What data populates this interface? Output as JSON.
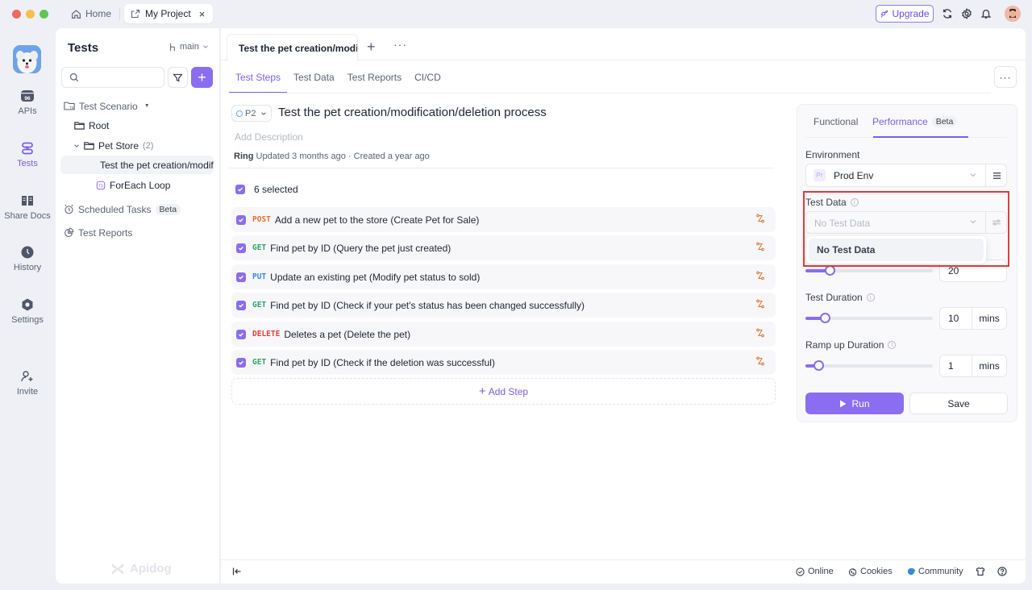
{
  "window": {
    "tabs": [
      {
        "label": "Home",
        "icon": "home-icon"
      },
      {
        "label": "My Project",
        "icon": "external-link-icon",
        "active": true
      }
    ],
    "upgrade_label": "Upgrade",
    "toolbar_icons": [
      "refresh-icon",
      "gear-icon",
      "bell-icon",
      "avatar"
    ]
  },
  "rail": {
    "items": [
      {
        "label": "APIs",
        "icon": "api-icon"
      },
      {
        "label": "Tests",
        "icon": "tests-icon",
        "active": true
      },
      {
        "label": "Share Docs",
        "icon": "book-icon"
      },
      {
        "label": "History",
        "icon": "clock-icon"
      },
      {
        "label": "Settings",
        "icon": "settings-icon"
      },
      {
        "label": "Invite",
        "icon": "user-plus-icon"
      }
    ]
  },
  "sidebar": {
    "title": "Tests",
    "branch": "main",
    "search": {
      "value": "",
      "placeholder": ""
    },
    "tree": {
      "scenario_label": "Test Scenario",
      "root_label": "Root",
      "folder_label": "Pet Store",
      "folder_count": "(2)",
      "cases": [
        "Test the pet creation/modification/deletion process",
        "ForEach Loop"
      ]
    },
    "scheduled_label": "Scheduled Tasks",
    "scheduled_badge": "Beta",
    "reports_label": "Test Reports",
    "brand": "Apidog"
  },
  "main": {
    "doc_tab_label": "Test the pet creation/modification/deletion process",
    "sub_tabs": [
      "Test Steps",
      "Test Data",
      "Test Reports",
      "CI/CD"
    ],
    "active_sub_tab": "Test Steps",
    "priority": "P2",
    "title": "Test the pet creation/modification/deletion process",
    "description_placeholder": "Add Description",
    "meta": {
      "author": "Ring",
      "updated": "Updated 3 months ago",
      "separator": "·",
      "created": "Created a year ago"
    },
    "selected_label": "6 selected",
    "steps": [
      {
        "method": "POST",
        "color": "#e5702a",
        "label": "Add a new pet to the store (Create Pet for Sale)",
        "checked": true
      },
      {
        "method": "GET",
        "color": "#2fa36b",
        "label": "Find pet by ID (Query the pet just created)",
        "checked": true
      },
      {
        "method": "PUT",
        "color": "#3a86e8",
        "label": "Update an existing pet (Modify pet status to sold)",
        "checked": true
      },
      {
        "method": "GET",
        "color": "#2fa36b",
        "label": "Find pet by ID (Check if your pet's status has been changed successfully)",
        "checked": true
      },
      {
        "method": "DELETE",
        "color": "#e0413a",
        "label": "Deletes a pet (Delete the pet)",
        "checked": true
      },
      {
        "method": "GET",
        "color": "#2fa36b",
        "label": "Find pet by ID (Check if the deletion was successful)",
        "checked": true
      }
    ],
    "add_step_label": "Add Step"
  },
  "run_panel": {
    "tabs": [
      "Functional",
      "Performance"
    ],
    "active_tab": "Performance",
    "performance_badge": "Beta",
    "environment_label": "Environment",
    "environment_badge": "Pr",
    "environment_value": "Prod Env",
    "test_data_label": "Test Data",
    "test_data_value": "No Test Data",
    "test_data_options": [
      "No Test Data"
    ],
    "virtual_users_value": "20",
    "virtual_users_fraction": 0.19,
    "test_duration_label": "Test Duration",
    "test_duration_value": "10",
    "test_duration_unit": "mins",
    "test_duration_fraction": 0.15,
    "ramp_label": "Ramp up Duration",
    "ramp_value": "1",
    "ramp_unit": "mins",
    "ramp_fraction": 0.1,
    "run_label": "Run",
    "save_label": "Save",
    "highlight_color": "#e03a3a"
  },
  "bottom_bar": {
    "online": "Online",
    "cookies": "Cookies",
    "community": "Community"
  }
}
